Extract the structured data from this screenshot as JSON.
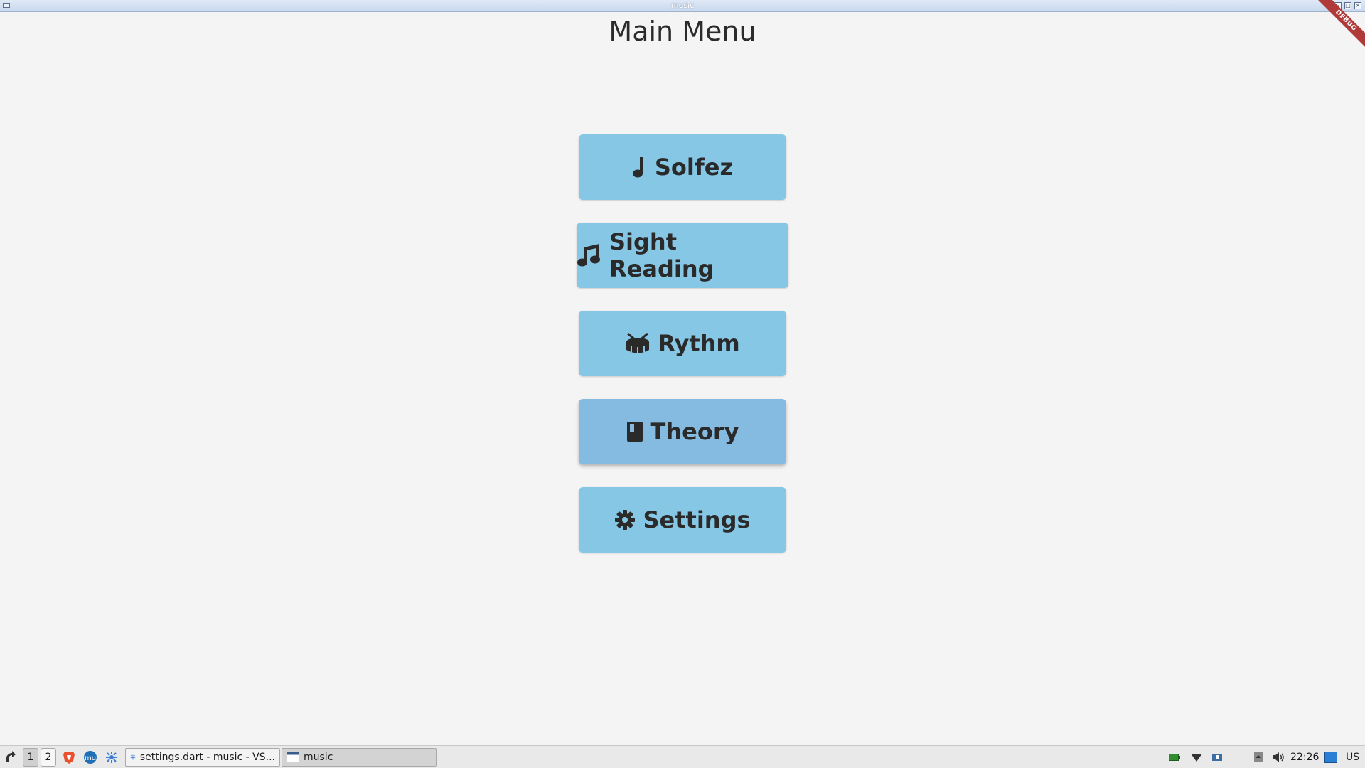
{
  "window": {
    "title": "music",
    "debug_banner": "DEBUG"
  },
  "page": {
    "title": "Main Menu"
  },
  "menu": {
    "items": [
      {
        "label": "Solfez",
        "icon": "music-note-icon"
      },
      {
        "label": "Sight Reading",
        "icon": "music-notes-icon"
      },
      {
        "label": "Rythm",
        "icon": "drum-icon"
      },
      {
        "label": "Theory",
        "icon": "book-icon"
      },
      {
        "label": "Settings",
        "icon": "gear-icon"
      }
    ]
  },
  "taskbar": {
    "workspaces": [
      "1",
      "2"
    ],
    "tasks": [
      {
        "label": "settings.dart - music - VS...",
        "icon": "vscode-icon"
      },
      {
        "label": "music",
        "icon": "window-icon"
      }
    ],
    "clock": "22:26",
    "keyboard_layout": "US"
  },
  "colors": {
    "button": "#87c7e6",
    "button_hover": "#85bbe0",
    "background": "#f4f4f4",
    "text": "#2b2b2b"
  }
}
